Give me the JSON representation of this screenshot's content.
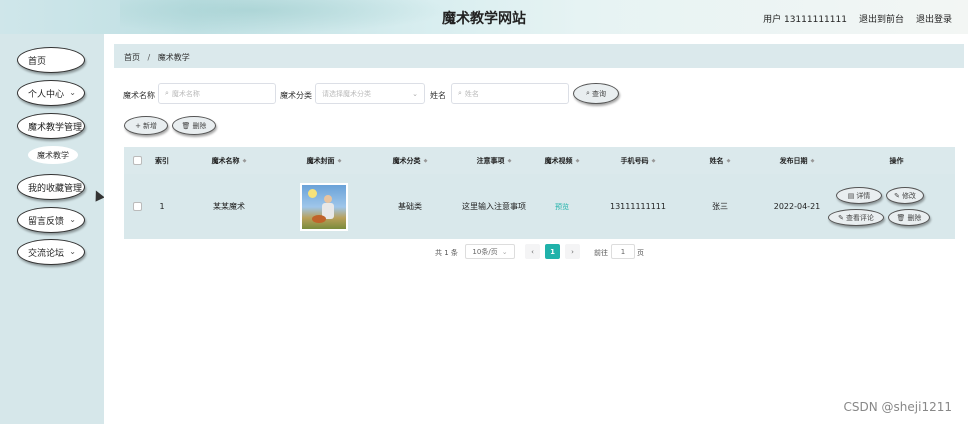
{
  "header": {
    "title": "魔术教学网站",
    "user_label": "用户 13111111111",
    "back_link": "退出到前台",
    "logout_link": "退出登录"
  },
  "sidebar": {
    "items": [
      {
        "label": "首页",
        "has_chevron": false
      },
      {
        "label": "个人中心",
        "has_chevron": true
      },
      {
        "label": "魔术教学管理",
        "has_chevron": false
      },
      {
        "label": "魔术教学",
        "sub": true
      },
      {
        "label": "我的收藏管理",
        "has_chevron": false
      },
      {
        "label": "留言反馈",
        "has_chevron": true
      },
      {
        "label": "交流论坛",
        "has_chevron": true
      }
    ]
  },
  "breadcrumb": {
    "home": "首页",
    "separator": "/",
    "current": "魔术教学"
  },
  "search": {
    "name_label": "魔术名称",
    "name_placeholder": "魔术名称",
    "category_label": "魔术分类",
    "category_placeholder": "请选择魔术分类",
    "author_label": "姓名",
    "author_placeholder": "姓名",
    "query_button": "查询"
  },
  "actions": {
    "add_button": "新增",
    "delete_button": "删除"
  },
  "table": {
    "headers": [
      "索引",
      "魔术名称",
      "魔术封面",
      "魔术分类",
      "注意事项",
      "魔术视频",
      "手机号码",
      "姓名",
      "发布日期",
      "操作"
    ],
    "rows": [
      {
        "index": "1",
        "name": "某某魔术",
        "category": "基础类",
        "notes": "这里输入注意事项",
        "video": "预览",
        "phone": "13111111111",
        "author": "张三",
        "date": "2022-04-21",
        "ops": {
          "detail": "详情",
          "edit": "修改",
          "comments": "查看评论",
          "delete": "删除"
        }
      }
    ]
  },
  "pagination": {
    "total": "共 1 条",
    "page_size": "10条/页",
    "current_page": "1",
    "goto_label": "前往",
    "goto_value": "1",
    "page_unit": "页"
  },
  "watermark": "CSDN @sheji1211",
  "colors": {
    "accent": "#20b2aa",
    "sidebar": "#d6e7ea",
    "table": "#dbe9ec"
  }
}
